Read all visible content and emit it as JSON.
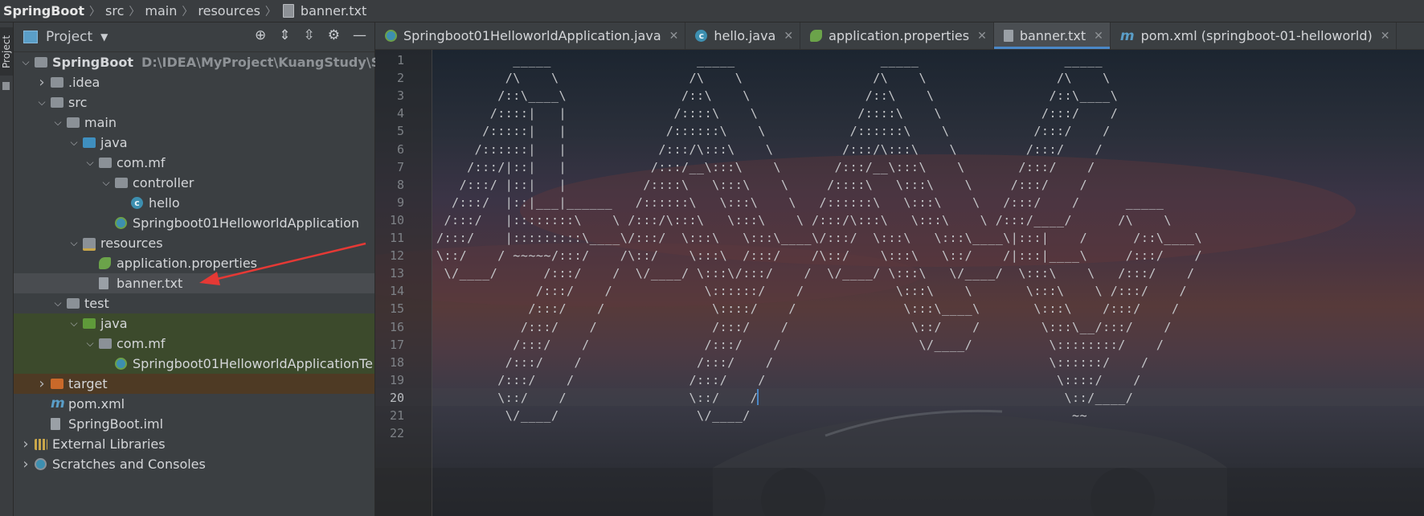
{
  "breadcrumb": {
    "items": [
      "SpringBoot",
      "src",
      "main",
      "resources",
      "banner.txt"
    ]
  },
  "left_strip": {
    "tab_label": "Project"
  },
  "project_panel": {
    "title": "Project",
    "tree": [
      {
        "label": "SpringBoot",
        "path": "D:\\IDEA\\MyProject\\KuangStudy\\SpringBo",
        "icon": "folder-icon",
        "depth": 0,
        "arrow": "down",
        "bold": true
      },
      {
        "label": ".idea",
        "icon": "folder-icon",
        "depth": 1,
        "arrow": "right"
      },
      {
        "label": "src",
        "icon": "folder-icon",
        "depth": 1,
        "arrow": "down"
      },
      {
        "label": "main",
        "icon": "folder-icon",
        "depth": 2,
        "arrow": "down"
      },
      {
        "label": "java",
        "icon": "source-folder-icon",
        "depth": 3,
        "arrow": "down"
      },
      {
        "label": "com.mf",
        "icon": "package-icon",
        "depth": 4,
        "arrow": "down"
      },
      {
        "label": "controller",
        "icon": "package-icon",
        "depth": 5,
        "arrow": "down"
      },
      {
        "label": "hello",
        "icon": "class-icon",
        "depth": 6,
        "arrow": ""
      },
      {
        "label": "Springboot01HelloworldApplication",
        "icon": "springboot-app-icon",
        "depth": 5,
        "arrow": ""
      },
      {
        "label": "resources",
        "icon": "resources-folder-icon",
        "depth": 3,
        "arrow": "down"
      },
      {
        "label": "application.properties",
        "icon": "spring-leaf-icon",
        "depth": 4,
        "arrow": ""
      },
      {
        "label": "banner.txt",
        "icon": "text-file-icon",
        "depth": 4,
        "arrow": "",
        "selected": true
      },
      {
        "label": "test",
        "icon": "folder-icon",
        "depth": 2,
        "arrow": "down"
      },
      {
        "label": "java",
        "icon": "test-folder-icon",
        "depth": 3,
        "arrow": "down",
        "highlight": "green"
      },
      {
        "label": "com.mf",
        "icon": "package-icon",
        "depth": 4,
        "arrow": "down",
        "highlight": "green"
      },
      {
        "label": "Springboot01HelloworldApplicationTe",
        "icon": "springboot-app-icon",
        "depth": 5,
        "arrow": "",
        "highlight": "green"
      },
      {
        "label": "target",
        "icon": "excluded-folder-icon",
        "depth": 1,
        "arrow": "right",
        "highlight": "orange"
      },
      {
        "label": "pom.xml",
        "icon": "maven-icon",
        "depth": 1,
        "arrow": ""
      },
      {
        "label": "SpringBoot.iml",
        "icon": "module-file-icon",
        "depth": 1,
        "arrow": ""
      },
      {
        "label": "External Libraries",
        "icon": "libraries-icon",
        "depth": 0,
        "arrow": "right"
      },
      {
        "label": "Scratches and Consoles",
        "icon": "scratches-icon",
        "depth": 0,
        "arrow": "right"
      }
    ]
  },
  "tabs": [
    {
      "label": "Springboot01HelloworldApplication.java",
      "icon": "springboot-app-icon",
      "active": false
    },
    {
      "label": "hello.java",
      "icon": "class-icon",
      "active": false
    },
    {
      "label": "application.properties",
      "icon": "spring-leaf-icon",
      "active": false
    },
    {
      "label": "banner.txt",
      "icon": "text-file-icon",
      "active": true
    },
    {
      "label": "pom.xml (springboot-01-helloworld)",
      "icon": "maven-icon",
      "active": false
    }
  ],
  "editor": {
    "current_line": 20,
    "lines": [
      "          _____                   _____                   _____                   _____",
      "         /\\    \\                 /\\    \\                 /\\    \\                 /\\    \\",
      "        /::\\____\\               /::\\    \\               /::\\    \\               /::\\____\\",
      "       /::::|   |              /::::\\    \\             /::::\\    \\             /:::/    /",
      "      /:::::|   |             /::::::\\    \\           /::::::\\    \\           /:::/    /",
      "     /::::::|   |            /:::/\\:::\\    \\         /:::/\\:::\\    \\         /:::/    /",
      "    /:::/|::|   |           /:::/__\\:::\\    \\       /:::/__\\:::\\    \\       /:::/    /",
      "   /:::/ |::|   |          /::::\\   \\:::\\    \\     /::::\\   \\:::\\    \\     /:::/    /",
      "  /:::/  |::|___|______   /::::::\\   \\:::\\    \\   /::::::\\   \\:::\\    \\   /:::/    /      _____",
      " /:::/   |::::::::\\    \\ /:::/\\:::\\   \\:::\\    \\ /:::/\\:::\\   \\:::\\    \\ /:::/____/      /\\    \\",
      "/:::/    |:::::::::\\____\\/:::/  \\:::\\   \\:::\\____\\/:::/  \\:::\\   \\:::\\____\\|:::|    /      /::\\____\\",
      "\\::/    / ~~~~~/:::/    /\\::/    \\:::\\  /:::/    /\\::/    \\:::\\   \\::/    /|:::|____\\     /:::/    /",
      " \\/____/      /:::/    /  \\/____/ \\:::\\/:::/    /  \\/____/ \\:::\\   \\/____/  \\:::\\    \\   /:::/    /",
      "             /:::/    /            \\::::::/    /            \\:::\\    \\       \\:::\\    \\ /:::/    /",
      "            /:::/    /              \\::::/    /              \\:::\\____\\       \\:::\\    /:::/    /",
      "           /:::/    /               /:::/    /                \\::/    /        \\:::\\__/:::/    /",
      "          /:::/    /               /:::/    /                  \\/____/          \\::::::::/    /",
      "         /:::/    /               /:::/    /                                    \\::::::/    /",
      "        /:::/    /               /:::/    /                                      \\::::/    /",
      "        \\::/    /                \\::/    /                                        \\::/____/",
      "         \\/____/                  \\/____/                                          ~~",
      ""
    ]
  }
}
